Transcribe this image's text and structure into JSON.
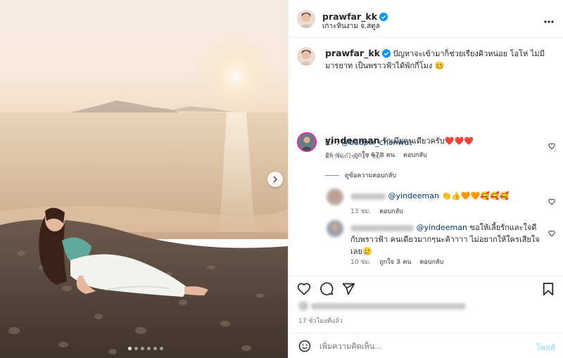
{
  "post": {
    "username": "prawfar_kk",
    "location": "เกาะหินงาม จ.สตูล",
    "caption_text": "ปัญหาจะเข้ามาก็ช่วยเรียงคิวหน่อย โอโห่ ไม่มีมารยาท เป็นพราวฟ้าได้พักกี่โมง 🥴",
    "credit_prefix": "Cr : ",
    "credit_link": "@badpix_chanwut",
    "edited_note": "มีการแก้ไข · 17 ชม.",
    "carousel": {
      "total_slides": 6,
      "active_slide": 1
    }
  },
  "comments": [
    {
      "username": "yindeeman",
      "text": "รักเมียคนเดียวครับ❤️❤️❤️",
      "time": "16 ชม.",
      "likes": "ถูกใจ 678 คน",
      "reply_label": "ตอบกลับ"
    }
  ],
  "view_replies_label": "ดูข้อความตอบกลับ",
  "replies": [
    {
      "mention": "@yindeeman",
      "text": " 👏👍🧡🧡🥰🥰🥰",
      "time": "13 ชม.",
      "reply_label": "ตอบกลับ"
    },
    {
      "mention": "@yindeeman",
      "text_line1": " ขอให้เลี้ยรักและใจดี",
      "text_line2": "กับพราวฟ้า คนเดียวมากๆนะค้าาาา ไม่อยากให้ใครเสียใจ",
      "text_line3": "เลย🥲",
      "time": "10 ชม.",
      "likes": "ถูกใจ 3 คน",
      "reply_label": "ตอบกลับ"
    }
  ],
  "time_ago": "17 ชั่วโมงที่แล้ว",
  "comment_input": {
    "placeholder": "เพิ่มความคิดเห็น..."
  },
  "post_button_label": "โพสต์",
  "icons": {
    "verified": "verified-badge-icon",
    "more": "more-options-icon",
    "like": "heart-icon",
    "comment": "comment-icon",
    "share": "send-icon",
    "save": "bookmark-icon",
    "emoji": "emoji-icon",
    "next": "chevron-right-icon"
  },
  "colors": {
    "verified": "#0095f6",
    "link": "#00376b",
    "post_button_disabled": "#b2dffc",
    "heart_red": "#ed4956"
  }
}
